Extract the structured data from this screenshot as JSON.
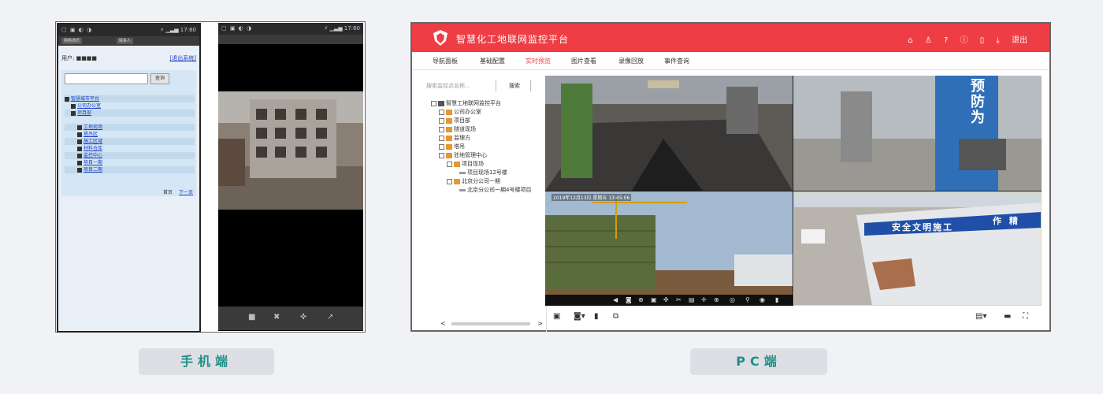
{
  "phone": {
    "status_left": "▢ ▣ ◐ ◑",
    "status_right": "⚡ ▁▃▅ 17:60",
    "tabs": [
      "网络通讯",
      "联系人"
    ],
    "header_text": "用户: ■■■■",
    "header_link": "[退出系统]",
    "search_button": "查询",
    "tree": [
      "智慧城市平台",
      "公司办公室",
      "项目部",
      "工地现场",
      "塔吊区",
      "施工区域",
      "材料仓库",
      "监控中心",
      "项目一期",
      "项目二期"
    ],
    "pager_first": "首页",
    "pager_next": "下一页",
    "controls": [
      "■",
      "✖",
      "✜",
      "↗"
    ]
  },
  "pc": {
    "title": "智慧化工地联网监控平台",
    "header_icons": [
      "⌂",
      "♙",
      "?",
      "ⓘ",
      "▯",
      "⤓",
      "退出"
    ],
    "nav": [
      "导航面板",
      "基础配置",
      "实时预览",
      "图片查看",
      "录像回放",
      "事件查询"
    ],
    "active_nav": 2,
    "search_placeholder": "搜索监控点名称...",
    "search_button": "搜索",
    "tree": [
      "智慧工地联网监控平台",
      "公司办公室",
      "项目部",
      "隧道现场",
      "监理方",
      "塔吊",
      "驻地管理中心",
      "项目现场",
      "项目现场12号楼",
      "北京分公司一期",
      "北京分公司一期4号楼项目"
    ],
    "cam3_timestamp": "2019年12月13日 星期五 13:45:06",
    "cam2_sign": "预防为",
    "cam4_banner": "安全文明施工",
    "cam4_banner2": "作 精",
    "scroll_left": "<",
    "scroll_right": ">"
  },
  "labels": {
    "mobile": "手机端",
    "pc": "PC端"
  }
}
